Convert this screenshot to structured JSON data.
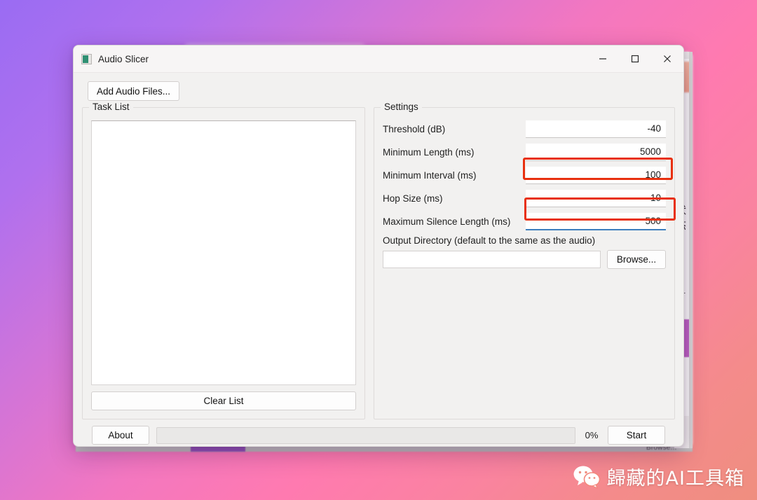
{
  "window": {
    "title": "Audio Slicer",
    "icon": "app-icon",
    "controls": {
      "minimize": "–",
      "maximize": "☐",
      "close": "✕"
    }
  },
  "toolbar": {
    "add_audio_files": "Add Audio Files..."
  },
  "task_panel": {
    "title": "Task List",
    "items": [],
    "clear_label": "Clear List"
  },
  "settings_panel": {
    "title": "Settings",
    "rows": [
      {
        "label": "Threshold (dB)",
        "value": "-40",
        "highlighted": false,
        "focused": false
      },
      {
        "label": "Minimum Length (ms)",
        "value": "5000",
        "highlighted": false,
        "focused": false
      },
      {
        "label": "Minimum Interval (ms)",
        "value": "100",
        "highlighted": true,
        "focused": false
      },
      {
        "label": "Hop Size (ms)",
        "value": "10",
        "highlighted": false,
        "focused": false
      },
      {
        "label": "Maximum Silence Length (ms)",
        "value": "500",
        "highlighted": true,
        "focused": true
      }
    ],
    "output": {
      "label": "Output Directory (default to the same as the audio)",
      "value": "",
      "placeholder": "",
      "browse_label": "Browse..."
    }
  },
  "bottom_bar": {
    "about_label": "About",
    "progress_percent": "0%",
    "progress_value": 0,
    "start_label": "Start"
  },
  "watermark": {
    "text": "歸藏的AI工具箱",
    "icon": "wechat-icon"
  },
  "background": {
    "browse_ghost": "Browse...",
    "sliver_text": "状态",
    "sliver_tick": "一"
  },
  "colors": {
    "highlight": "#e8300f",
    "focus_underline": "#3d7ebd",
    "window_bg": "#f2f1f0",
    "titlebar_bg": "#f7f5f5",
    "desktop_gradient_start": "#9a6cf3",
    "desktop_gradient_mid": "#ff7ab0",
    "desktop_gradient_end": "#ef8e7f"
  }
}
